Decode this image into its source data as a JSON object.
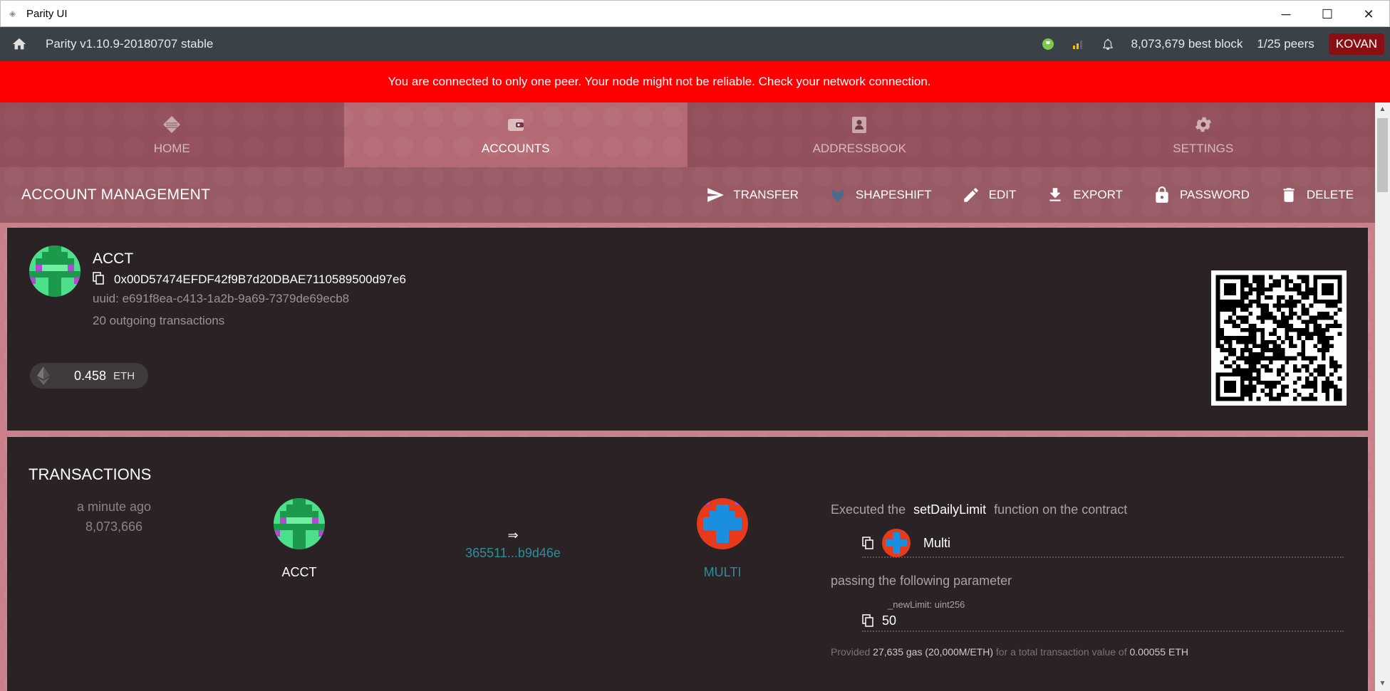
{
  "window": {
    "title": "Parity UI",
    "minimize": "─",
    "maximize": "☐",
    "close": "✕"
  },
  "statusbar": {
    "version": "Parity v1.10.9-20180707 stable",
    "best_block": "8,073,679 best block",
    "peers": "1/25 peers",
    "chain": "KOVAN",
    "icons": [
      "home-icon",
      "signer-icon",
      "signal-icon",
      "bell-icon"
    ]
  },
  "warning": {
    "text": "You are connected to only one peer. Your node might not be reliable. Check your network connection."
  },
  "tabs": [
    {
      "label": "HOME",
      "icon": "home-diamond-icon",
      "active": false
    },
    {
      "label": "ACCOUNTS",
      "icon": "wallet-icon",
      "active": true
    },
    {
      "label": "ADDRESSBOOK",
      "icon": "contacts-icon",
      "active": false
    },
    {
      "label": "SETTINGS",
      "icon": "gear-icon",
      "active": false
    }
  ],
  "actionbar": {
    "title": "ACCOUNT MANAGEMENT",
    "actions": [
      {
        "label": "TRANSFER",
        "icon": "send-icon"
      },
      {
        "label": "SHAPESHIFT",
        "icon": "shapeshift-fox-icon"
      },
      {
        "label": "EDIT",
        "icon": "pencil-icon"
      },
      {
        "label": "EXPORT",
        "icon": "download-icon"
      },
      {
        "label": "PASSWORD",
        "icon": "lock-icon"
      },
      {
        "label": "DELETE",
        "icon": "trash-icon"
      }
    ]
  },
  "account": {
    "name": "ACCT",
    "address": "0x00D57474EFDF42f9B7d20DBAE7110589500d97e6",
    "uuid": "uuid: e691f8ea-c413-1a2b-9a69-7379de69ecb8",
    "outgoing": "20 outgoing transactions",
    "balance_value": "0.458",
    "balance_unit": "ETH"
  },
  "transactions": {
    "title": "TRANSACTIONS",
    "items": [
      {
        "time": "a minute ago",
        "block": "8,073,666",
        "from": "ACCT",
        "arrow": "⇒",
        "hash": "365511...b9d46e",
        "to": "MULTI",
        "desc_prefix": "Executed the",
        "function": "setDailyLimit",
        "desc_suffix": "function on the contract",
        "contract_name": "Multi",
        "passing": "passing the following parameter",
        "param_label": "_newLimit: uint256",
        "param_value": "50",
        "gas_prefix": "Provided",
        "gas": "27,635 gas (20,000M/ETH)",
        "gas_mid": "for a total transaction value of",
        "total": "0.00055 ETH"
      }
    ]
  },
  "colors": {
    "banner": "#ff0000",
    "chain_badge": "#8b0f12",
    "link": "#2a8f9c",
    "card": "#2a2225"
  }
}
